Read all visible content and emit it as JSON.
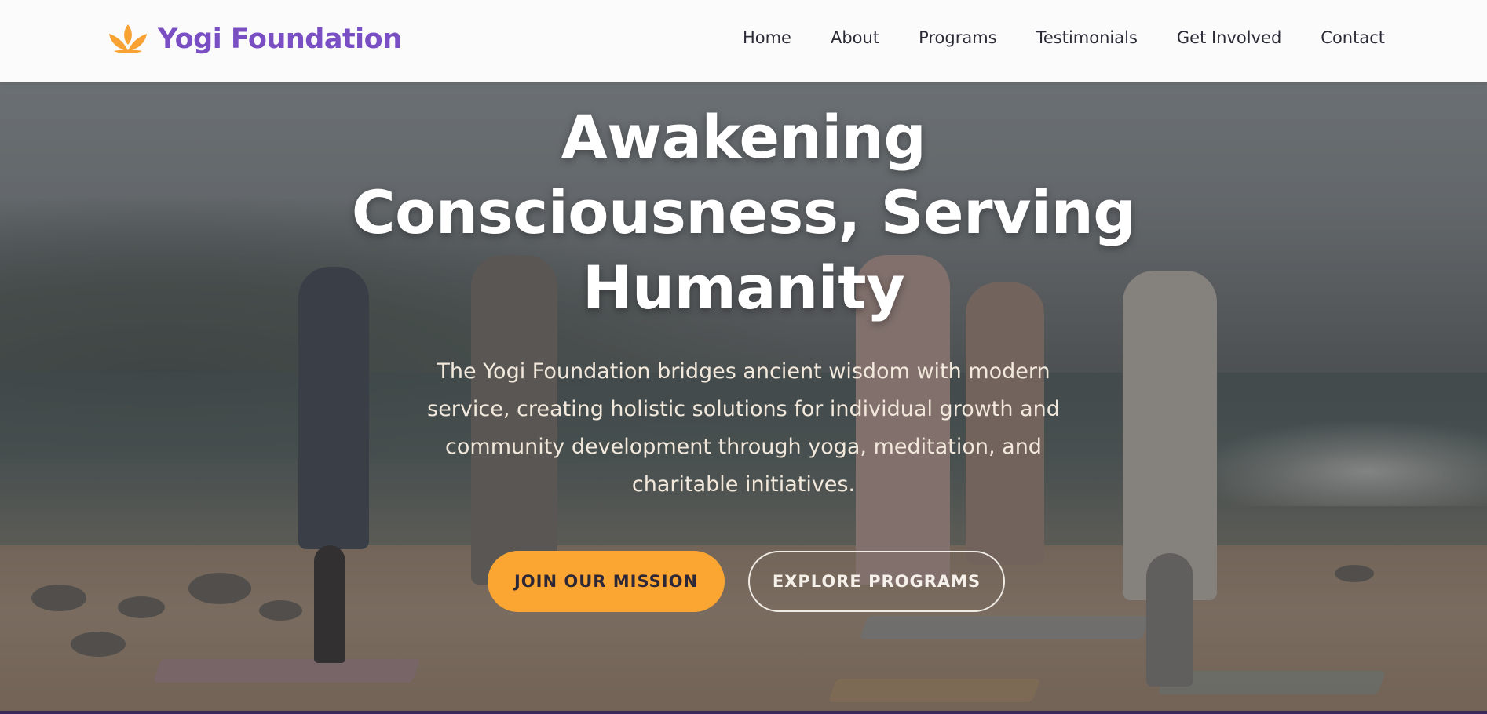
{
  "header": {
    "brand_name": "Yogi Foundation",
    "brand_icon": "lotus-icon",
    "brand_color": "#7a4fc4",
    "nav": [
      {
        "label": "Home"
      },
      {
        "label": "About"
      },
      {
        "label": "Programs"
      },
      {
        "label": "Testimonials"
      },
      {
        "label": "Get Involved"
      },
      {
        "label": "Contact"
      }
    ]
  },
  "hero": {
    "title": "Awakening Consciousness, Serving Humanity",
    "subtitle": "The Yogi Foundation bridges ancient wisdom with modern service, creating holistic solutions for individual growth and community development through yoga, meditation, and charitable initiatives.",
    "primary_button": "Join Our Mission",
    "secondary_button": "Explore Programs",
    "accent_color": "#fba632"
  }
}
